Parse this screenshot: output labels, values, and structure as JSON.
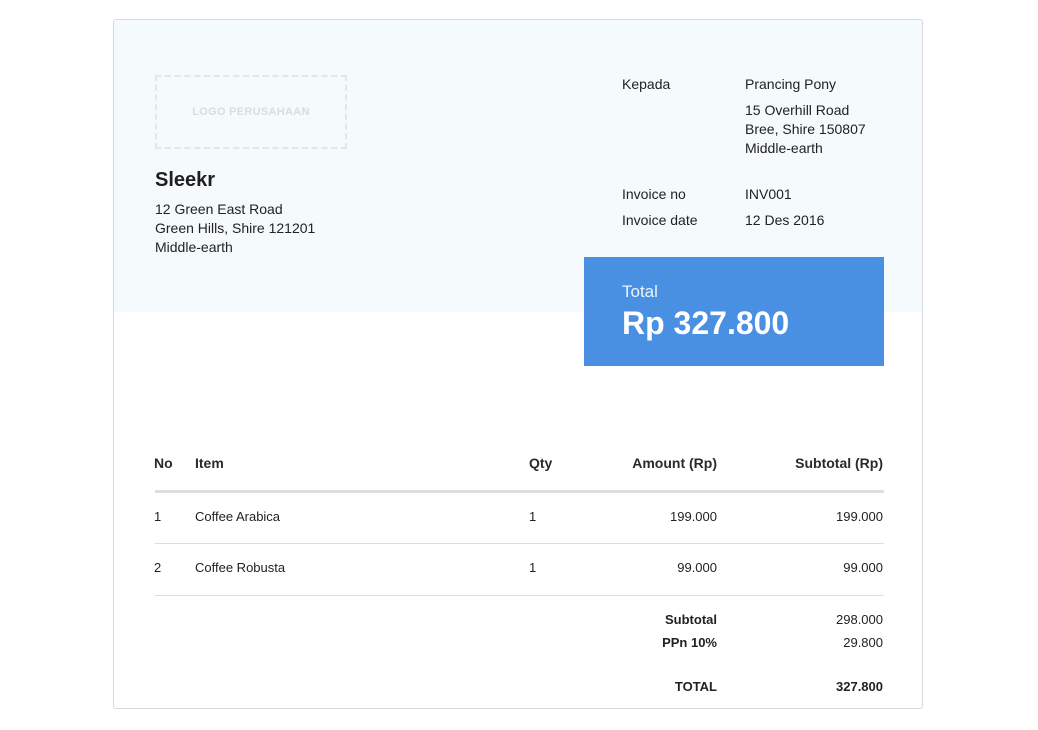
{
  "logo": {
    "placeholder": "LOGO PERUSAHAAN"
  },
  "company": {
    "name": "Sleekr",
    "address_lines": [
      "12 Green East Road",
      "Green Hills, Shire 121201",
      "Middle-earth"
    ]
  },
  "recipient": {
    "label": "Kepada",
    "name": "Prancing Pony",
    "address_lines": [
      "15 Overhill Road",
      "Bree, Shire 150807",
      "Middle-earth"
    ]
  },
  "invoice": {
    "no_label": "Invoice no",
    "no_value": "INV001",
    "date_label": "Invoice date",
    "date_value": "12 Des 2016"
  },
  "total_box": {
    "label": "Total",
    "amount": "Rp 327.800",
    "color": "#4a90e2"
  },
  "table": {
    "headers": {
      "no": "No",
      "item": "Item",
      "qty": "Qty",
      "amount": "Amount (Rp)",
      "subtotal": "Subtotal (Rp)"
    },
    "rows": [
      {
        "no": "1",
        "item": "Coffee Arabica",
        "qty": "1",
        "amount": "199.000",
        "subtotal": "199.000"
      },
      {
        "no": "2",
        "item": "Coffee Robusta",
        "qty": "1",
        "amount": "99.000",
        "subtotal": "99.000"
      }
    ]
  },
  "summary": {
    "subtotal_label": "Subtotal",
    "subtotal_value": "298.000",
    "tax_label": "PPn 10%",
    "tax_value": "29.800",
    "total_label": "TOTAL",
    "total_value": "327.800"
  }
}
